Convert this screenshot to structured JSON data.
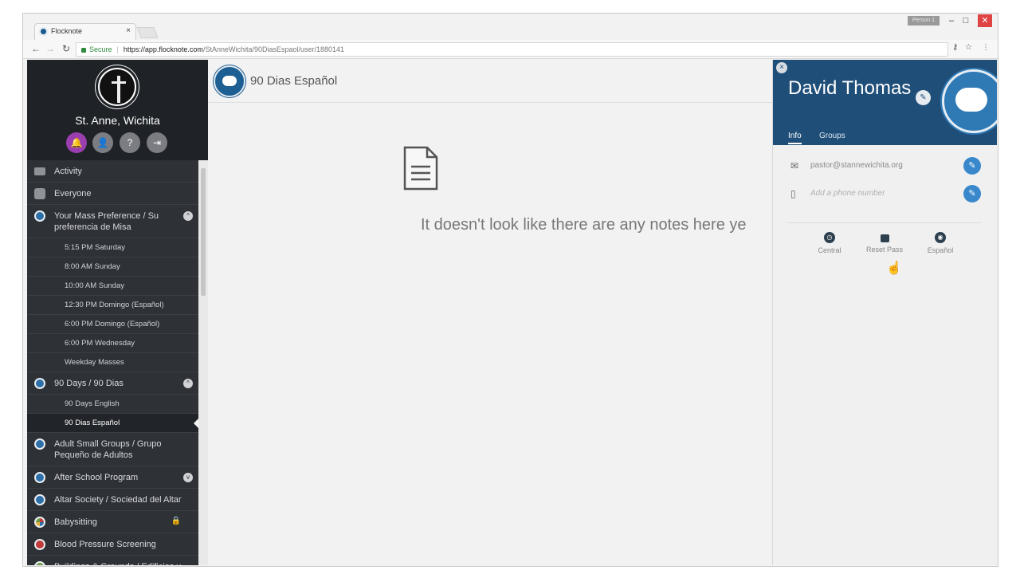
{
  "browser": {
    "tab_title": "Flocknote",
    "tab_close": "×",
    "person_label": "Person 1",
    "minimize": "–",
    "maximize": "□",
    "close": "✕",
    "back": "←",
    "forward": "→",
    "reload": "↻",
    "secure_label": "Secure",
    "url_host": "https://app.flocknote.com",
    "url_path": "/StAnneWichita/90DiasEspaol/user/1880141",
    "key_icon": "⚷",
    "star_icon": "☆",
    "menu_icon": "⋮"
  },
  "sidebar": {
    "church_name": "St. Anne, Wichita",
    "header_icons": [
      "🔔",
      "👤",
      "?",
      "⇥"
    ],
    "items": [
      {
        "label": "Activity"
      },
      {
        "label": "Everyone"
      },
      {
        "label": "Your Mass Preference / Su preferencia de Misa",
        "chevron": "^"
      },
      {
        "label": "90 Days / 90 Dias",
        "chevron": "^"
      },
      {
        "label": "Adult Small Groups / Grupo Pequeño de Adultos"
      },
      {
        "label": "After School Program",
        "chevron": "v"
      },
      {
        "label": "Altar Society / Sociedad del Altar"
      },
      {
        "label": "Babysitting",
        "lock": "🔒"
      },
      {
        "label": "Blood Pressure Screening"
      },
      {
        "label": "Buildings & Grounds / Edificios y Jardines"
      }
    ],
    "mass_sub": [
      "5:15 PM Saturday",
      "8:00 AM Sunday",
      "10:00 AM Sunday",
      "12:30 PM Domingo (Español)",
      "6:00 PM Domingo (Español)",
      "6:00 PM Wednesday",
      "Weekday Masses"
    ],
    "days_sub": [
      "90 Days English",
      "90 Dias Español"
    ]
  },
  "main": {
    "group_title": "90 Dias Español",
    "empty_message": "It doesn't look like there are any notes here ye"
  },
  "profile": {
    "close": "×",
    "name": "David Thomas",
    "edit_icon": "✎",
    "tabs": [
      "Info",
      "Groups"
    ],
    "email": "pastor@stannewichita.org",
    "phone_placeholder": "Add a phone number",
    "email_icon": "✉",
    "phone_icon": "▯",
    "actions": [
      {
        "label": "Central",
        "icon": "◷"
      },
      {
        "label": "Reset Pass",
        "icon": "▲"
      },
      {
        "label": "Español",
        "icon": "◉"
      }
    ],
    "cursor": "☝"
  },
  "colors": {
    "sidebar": "#2e3136",
    "profile_header": "#1f4e79",
    "accent": "#3a88cc"
  }
}
